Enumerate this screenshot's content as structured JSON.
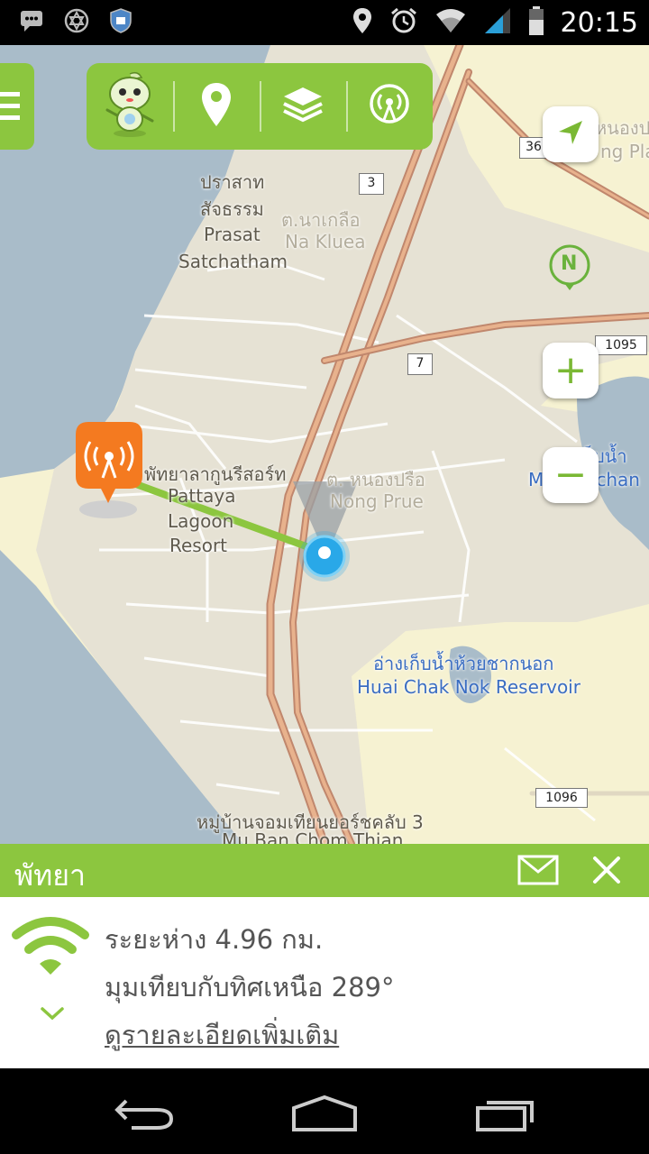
{
  "status_bar": {
    "time": "20:15",
    "left_icons": [
      "message-icon",
      "star-of-david-icon",
      "shield-badge-icon"
    ],
    "right_icons": [
      "location-icon",
      "alarm-icon",
      "wifi-icon",
      "signal-icon",
      "battery-icon"
    ]
  },
  "toolbar": {
    "items": [
      "mascot-icon",
      "location-pin-icon",
      "layers-icon",
      "cell-tower-icon"
    ]
  },
  "map": {
    "labels": {
      "prasat_thai": "ปราสาท",
      "prasat_thai2": "สัจธรรม",
      "prasat_en": "Prasat",
      "satchatham_en": "Satchatham",
      "nakluea_thai": "ต.นาเกลือ",
      "nakluea_en": "Na Kluea",
      "lagoon_thai": "พัทยาลากูนรีสอร์ท",
      "lagoon_en1": "Pattaya",
      "lagoon_en2": "Lagoon",
      "lagoon_en3": "Resort",
      "nongprue_thai": "ต. หนองปรือ",
      "nongprue_en": "Nong Prue",
      "reservoir_thai": "อ่างเก็บน้ำห้วยชากนอก",
      "reservoir_en": "Huai Chak Nok Reservoir",
      "muban_thai": "หมู่บ้านจอมเทียนยอร์ชคลับ 3",
      "muban_en": "Mu Ban Chom Thian",
      "right_thai": "อ่างเก็บน้ำ",
      "right_en": "Mabprachan",
      "top_right_thai": "หนองปล",
      "top_right_en": "ng Pla"
    },
    "shields": {
      "r3": "3",
      "r36": "36",
      "r7": "7",
      "r1095": "1095",
      "r1096": "1096"
    },
    "controls": {
      "zoom_in": "+",
      "zoom_out": "−",
      "north": "N"
    }
  },
  "panel": {
    "title": "พัทยา",
    "distance": "ระยะห่าง 4.96 กม.",
    "bearing": "มุมเทียบกับทิศเหนือ 289°",
    "more": "ดูรายละเอียดเพิ่มเติม"
  },
  "nav_bar": {
    "items": [
      "back-icon",
      "home-icon",
      "recent-apps-icon"
    ]
  },
  "colors": {
    "accent": "#8cc63f",
    "tower": "#f47a20",
    "location": "#29a8e8"
  }
}
